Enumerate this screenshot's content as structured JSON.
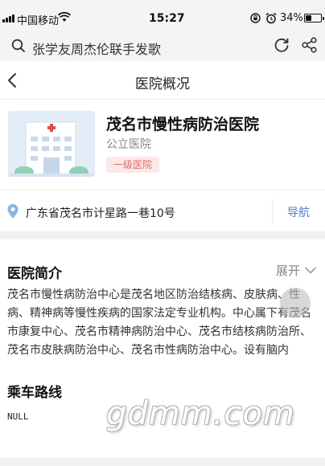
{
  "status_bar": {
    "carrier": "中国移动",
    "time": "15:27",
    "battery_percent": "34%",
    "battery_level": 0.34
  },
  "search": {
    "query": "张学友周杰伦联手发歌"
  },
  "nav": {
    "title": "医院概况"
  },
  "hospital": {
    "name": "茂名市慢性病防治医院",
    "type": "公立医院",
    "level": "一级医院",
    "address": "广东省茂名市计星路一巷10号",
    "navigate_label": "导航"
  },
  "intro": {
    "title": "医院简介",
    "expand_label": "展开",
    "text": "茂名市慢性病防治中心是茂名地区防治结核病、皮肤病、性病、精神病等慢性疾病的国家法定专业机构。中心属下有茂名市康复中心、茂名市精神病防治中心、茂名市结核病防治所、茂名市皮肤病防治中心、茂名市性病防治中心。设有脑内科、..."
  },
  "route": {
    "title": "乘车路线",
    "value": "NULL"
  },
  "watermark": {
    "text": "gdmm.com"
  },
  "colors": {
    "accent_blue": "#4d7fbf",
    "level_badge_bg": "#fde8e8",
    "level_badge_text": "#e46a6a",
    "topbar_bg": "#f4f4f6"
  }
}
